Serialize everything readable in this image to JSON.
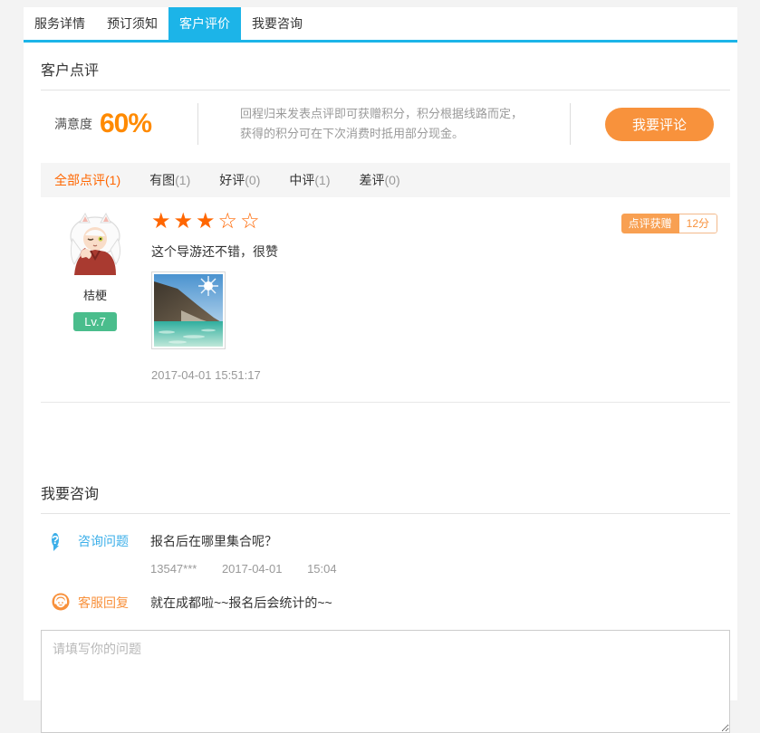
{
  "tabs": [
    {
      "label": "服务详情"
    },
    {
      "label": "预订须知"
    },
    {
      "label": "客户评价"
    },
    {
      "label": "我要咨询"
    }
  ],
  "review_section": {
    "title": "客户点评",
    "satisfaction_label": "满意度",
    "satisfaction_value": "60%",
    "promo_line1": "回程归来发表点评即可获赠积分，积分根据线路而定，",
    "promo_line2": "获得的积分可在下次消费时抵用部分现金。",
    "comment_button": "我要评论",
    "filters": [
      {
        "name": "全部点评",
        "count": "(1)",
        "active": true
      },
      {
        "name": "有图",
        "count": "(1)",
        "active": false
      },
      {
        "name": "好评",
        "count": "(0)",
        "active": false
      },
      {
        "name": "中评",
        "count": "(1)",
        "active": false
      },
      {
        "name": "差评",
        "count": "(0)",
        "active": false
      }
    ],
    "review": {
      "username": "桔梗",
      "level": "Lv.7",
      "rating": 3,
      "rating_max": 5,
      "stars_filled": "★★★",
      "stars_empty": "☆☆",
      "badge_label": "点评获赠",
      "badge_points": "12分",
      "text": "这个导游还不错，很赞",
      "timestamp": "2017-04-01 15:51:17"
    }
  },
  "consult_section": {
    "title": "我要咨询",
    "question_label": "咨询问题",
    "question_text": "报名后在哪里集合呢？",
    "question_user": "13547***",
    "question_date": "2017-04-01",
    "question_time": "15:04",
    "reply_label": "客服回复",
    "reply_text": "就在成都啦~~报名后会统计的~~",
    "input_placeholder": "请填写你的问题"
  },
  "colors": {
    "accent_cyan": "#1cb4e8",
    "accent_orange": "#ff8a00",
    "button_orange": "#f8923c",
    "star_orange": "#ff6600",
    "level_green": "#4abd8c",
    "question_blue": "#3cafe9"
  }
}
